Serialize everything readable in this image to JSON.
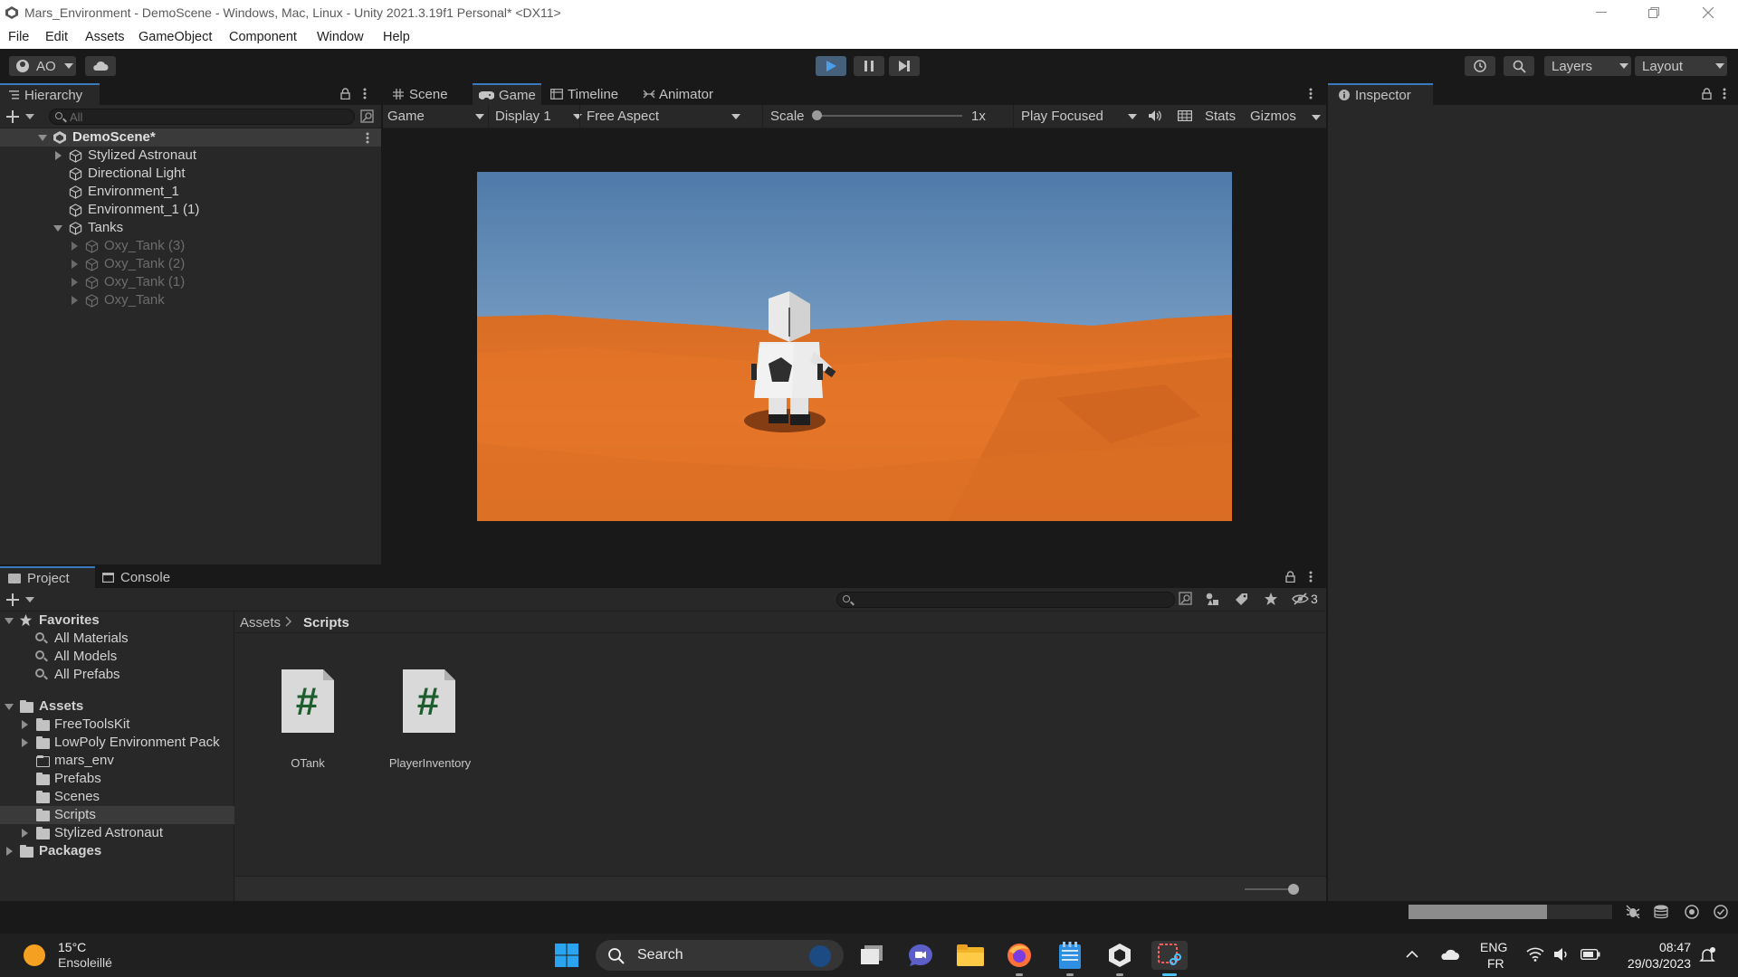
{
  "window": {
    "title": "Mars_Environment - DemoScene - Windows, Mac, Linux - Unity 2021.3.19f1 Personal* <DX11>"
  },
  "menu": [
    "File",
    "Edit",
    "Assets",
    "GameObject",
    "Component",
    "Window",
    "Help"
  ],
  "toolbar": {
    "account": "AO",
    "layers": "Layers",
    "layout": "Layout"
  },
  "hierarchy": {
    "tab": "Hierarchy",
    "search_placeholder": "All",
    "scene": "DemoScene*",
    "items": [
      {
        "label": "Stylized Astronaut"
      },
      {
        "label": "Directional Light"
      },
      {
        "label": "Environment_1"
      },
      {
        "label": "Environment_1 (1)"
      },
      {
        "label": "Tanks"
      },
      {
        "label": "Oxy_Tank (3)"
      },
      {
        "label": "Oxy_Tank (2)"
      },
      {
        "label": "Oxy_Tank (1)"
      },
      {
        "label": "Oxy_Tank"
      }
    ]
  },
  "center_tabs": [
    "Scene",
    "Game",
    "Timeline",
    "Animator"
  ],
  "game_toolbar": {
    "view": "Game",
    "display": "Display 1",
    "aspect": "Free Aspect",
    "scale_label": "Scale",
    "scale_value": "1x",
    "play_mode": "Play Focused",
    "stats": "Stats",
    "gizmos": "Gizmos"
  },
  "inspector": {
    "tab": "Inspector"
  },
  "project": {
    "tabs": [
      "Project",
      "Console"
    ],
    "hidden_count": "3",
    "favorites_label": "Favorites",
    "favorites": [
      "All Materials",
      "All Models",
      "All Prefabs"
    ],
    "assets_label": "Assets",
    "folders": [
      "FreeToolsKit",
      "LowPoly Environment Pack",
      "mars_env",
      "Prefabs",
      "Scenes",
      "Scripts",
      "Stylized Astronaut"
    ],
    "packages_label": "Packages",
    "breadcrumb": [
      "Assets",
      "Scripts"
    ],
    "files": [
      "OTank",
      "PlayerInventory"
    ],
    "zoom_level": 0.9
  },
  "taskbar": {
    "temperature": "15°C",
    "weather": "Ensoleillé",
    "search": "Search",
    "lang1": "ENG",
    "lang2": "FR",
    "time": "08:47",
    "date": "29/03/2023"
  }
}
